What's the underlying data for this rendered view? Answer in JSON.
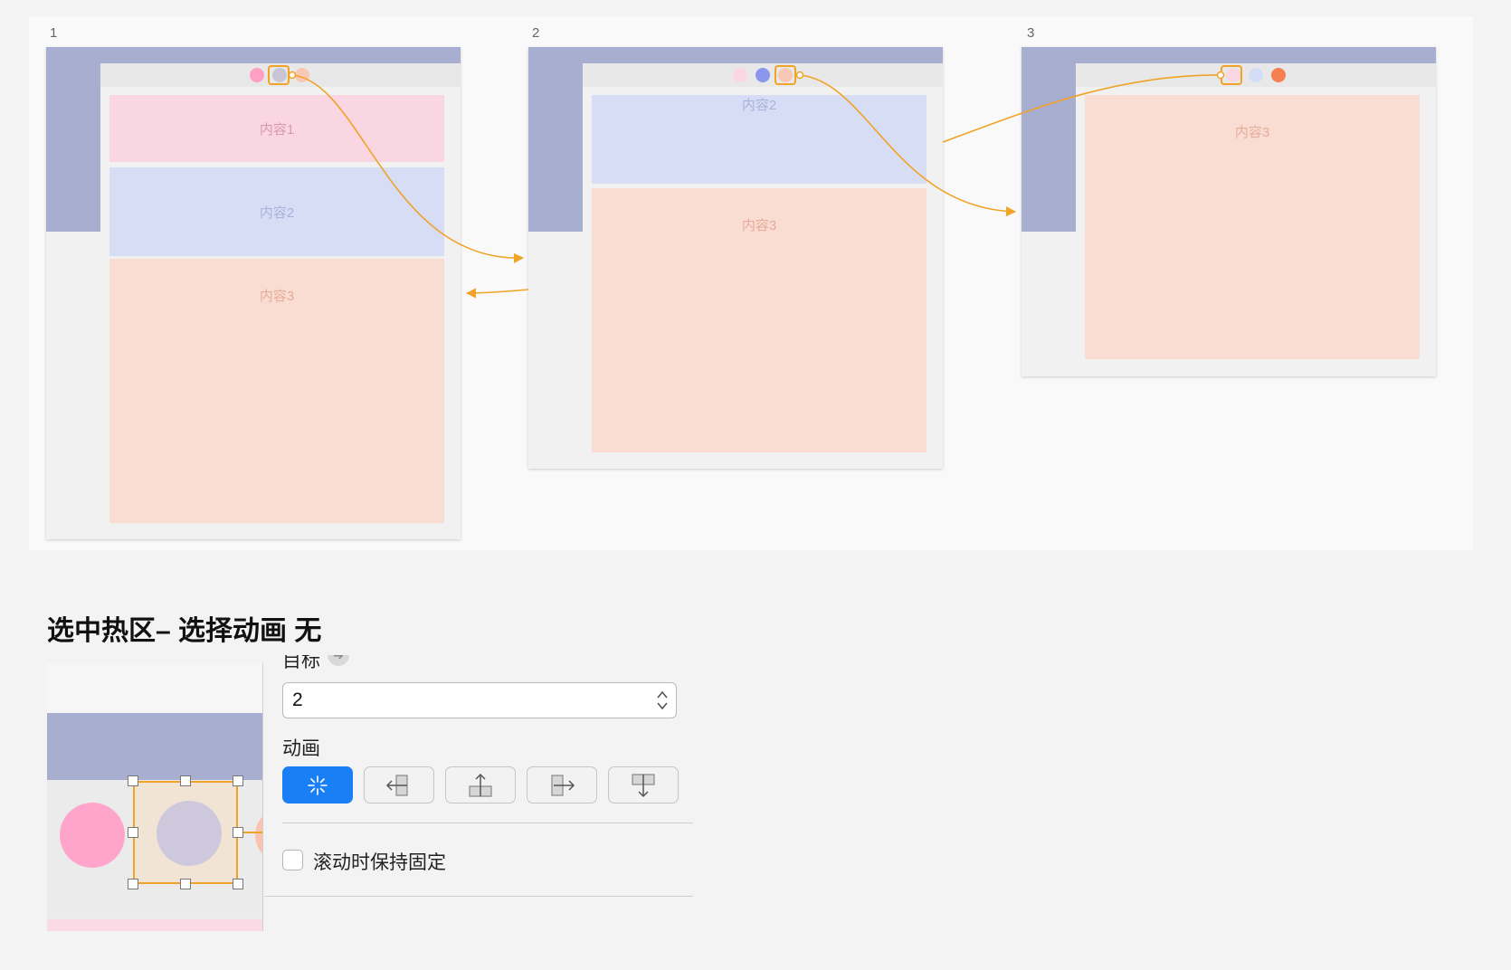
{
  "artboards": [
    {
      "number": "1",
      "blocks": [
        "内容1",
        "内容2",
        "内容3"
      ]
    },
    {
      "number": "2",
      "blocks": [
        "内容2",
        "内容3"
      ]
    },
    {
      "number": "3",
      "blocks": [
        "内容3"
      ]
    }
  ],
  "colors": {
    "accent_link": "#f0a326",
    "header_bar": "#a8aed0",
    "block_pink": "#fad6e2",
    "block_blue": "#d7ddf5",
    "block_peach": "#f9ddd3",
    "dot_pink": "#ff9fc4",
    "dot_blue": "#8b96ee",
    "dot_orange": "#f6804f",
    "primary_button": "#1a7ef5"
  },
  "section_title": "选中热区– 选择动画 无",
  "panel": {
    "target_label": "目标",
    "target_value": "2",
    "animation_label": "动画",
    "animation_options": [
      "none-sparkle-icon",
      "slide-left-icon",
      "slide-up-icon",
      "slide-right-icon",
      "slide-down-icon"
    ],
    "selected_animation": "none-sparkle-icon",
    "fixed_on_scroll_label": "滚动时保持固定",
    "fixed_on_scroll_checked": false
  }
}
